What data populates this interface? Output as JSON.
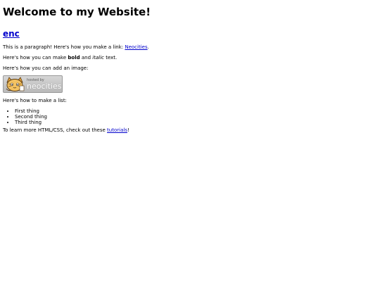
{
  "page": {
    "title": "Welcome to my Website!",
    "subtitle_link": "enc",
    "para1_prefix": "This is a paragraph! Here's how you make a link: ",
    "para1_link": "Neocities",
    "para1_suffix": ".",
    "para2_prefix": "Here's how you can make ",
    "para2_bold": "bold",
    "para2_middle": " and ",
    "para2_italic": "italic",
    "para2_suffix": " text.",
    "para3": "Here's how you can add an image:",
    "badge": {
      "small_text": "hosted by",
      "big_text": "neocities",
      "icon": "neocities-cat-icon"
    },
    "para4": "Here's how to make a list:",
    "list": [
      "First thing",
      "Second thing",
      "Third thing"
    ],
    "para5_prefix": "To learn more HTML/CSS, check out these ",
    "para5_link": "tutorials",
    "para5_suffix": "!"
  },
  "colors": {
    "link": "#0000cc",
    "text": "#000000",
    "background": "#ffffff"
  }
}
